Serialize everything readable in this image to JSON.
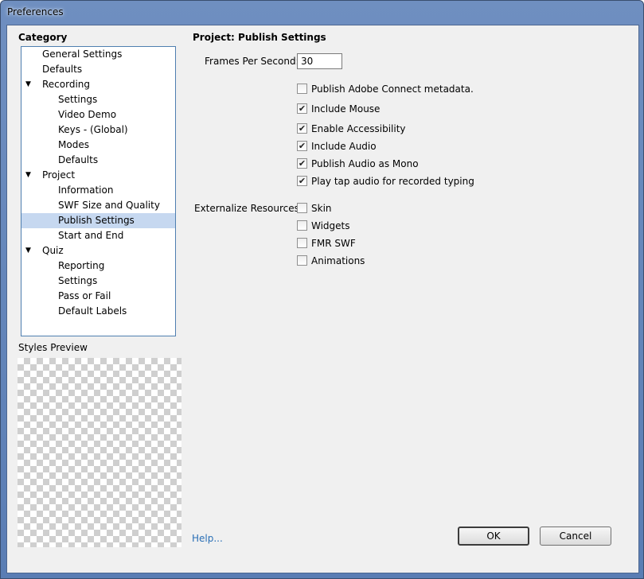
{
  "window": {
    "title": "Preferences"
  },
  "category": {
    "label": "Category",
    "items": [
      {
        "label": "General Settings",
        "level": 0,
        "expander": ""
      },
      {
        "label": "Defaults",
        "level": 0,
        "expander": ""
      },
      {
        "label": "Recording",
        "level": 0,
        "expander": "▼"
      },
      {
        "label": "Settings",
        "level": 1,
        "expander": ""
      },
      {
        "label": "Video Demo",
        "level": 1,
        "expander": ""
      },
      {
        "label": "Keys - (Global)",
        "level": 1,
        "expander": ""
      },
      {
        "label": "Modes",
        "level": 1,
        "expander": ""
      },
      {
        "label": "Defaults",
        "level": 1,
        "expander": ""
      },
      {
        "label": "Project",
        "level": 0,
        "expander": "▼"
      },
      {
        "label": "Information",
        "level": 1,
        "expander": ""
      },
      {
        "label": "SWF Size and Quality",
        "level": 1,
        "expander": ""
      },
      {
        "label": "Publish Settings",
        "level": 1,
        "expander": "",
        "selected": true
      },
      {
        "label": "Start and End",
        "level": 1,
        "expander": ""
      },
      {
        "label": "Quiz",
        "level": 0,
        "expander": "▼"
      },
      {
        "label": "Reporting",
        "level": 1,
        "expander": ""
      },
      {
        "label": "Settings",
        "level": 1,
        "expander": ""
      },
      {
        "label": "Pass or Fail",
        "level": 1,
        "expander": ""
      },
      {
        "label": "Default Labels",
        "level": 1,
        "expander": ""
      }
    ]
  },
  "styles_preview": {
    "label": "Styles Preview"
  },
  "panel": {
    "title": "Project: Publish Settings",
    "fps": {
      "label": "Frames Per Second:",
      "value": "30"
    },
    "options": [
      {
        "label": "Publish Adobe Connect metadata.",
        "checked": false
      },
      {
        "label": "Include Mouse",
        "checked": true
      },
      {
        "label": "Enable Accessibility",
        "checked": true
      },
      {
        "label": "Include Audio",
        "checked": true
      },
      {
        "label": "Publish Audio as Mono",
        "checked": true
      },
      {
        "label": "Play tap audio for recorded typing",
        "checked": true
      }
    ],
    "externalize": {
      "label": "Externalize Resources:",
      "options": [
        {
          "label": "Skin",
          "checked": false
        },
        {
          "label": "Widgets",
          "checked": false
        },
        {
          "label": "FMR SWF",
          "checked": false
        },
        {
          "label": "Animations",
          "checked": false
        }
      ]
    }
  },
  "footer": {
    "help": "Help...",
    "ok": "OK",
    "cancel": "Cancel"
  }
}
